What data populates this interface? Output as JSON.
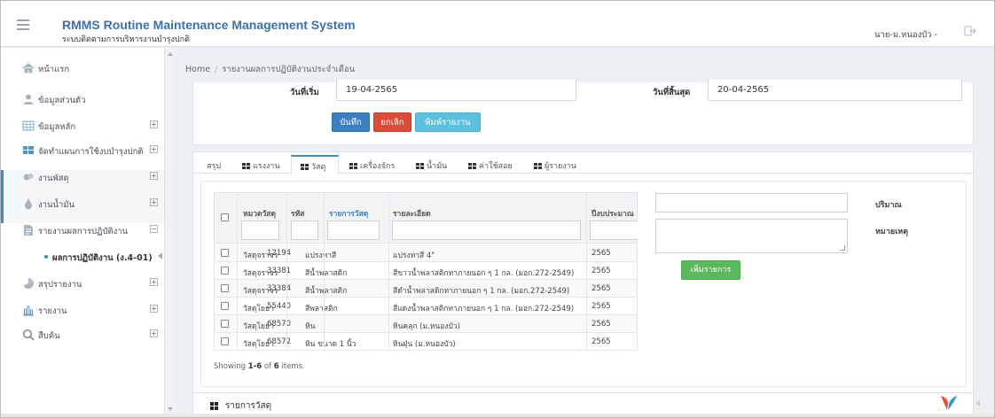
{
  "header": {
    "title": "RMMS Routine Maintenance Management System",
    "subtitle": "ระบบติดตามการบริหารงานบำรุงปกติ",
    "user": "นาย-ม.หนองบัว -"
  },
  "sidebar": {
    "items": [
      {
        "label": "หน้าแรก",
        "icon": "home-icon"
      },
      {
        "label": "ข้อมูลส่วนตัว",
        "icon": "user-icon"
      },
      {
        "label": "ข้อมูลหลัก",
        "icon": "table-icon"
      },
      {
        "label": "จัดทำแผนการใช้งบบำรุงปกติ",
        "icon": "plan-icon"
      },
      {
        "label": "งานพัสดุ",
        "icon": "parcel-icon"
      },
      {
        "label": "งานน้ำมัน",
        "icon": "oil-icon"
      },
      {
        "label": "รายงานผลการปฏิบัติงาน",
        "icon": "report-icon"
      },
      {
        "label": "ผลการปฏิบัติงาน (ง.4-01)",
        "icon": "dot-icon"
      },
      {
        "label": "สรุปรายงาน",
        "icon": "pie-icon"
      },
      {
        "label": "รายงาน",
        "icon": "bar-chart-icon"
      },
      {
        "label": "สืบค้น",
        "icon": "search-icon"
      }
    ]
  },
  "breadcrumb": {
    "home": "Home",
    "current": "รายงานผลการปฏิบัติงานประจำเดือน"
  },
  "form": {
    "start_label": "วันที่เริ่ม",
    "start_value": "19-04-2565",
    "end_label": "วันที่สิ้นสุด",
    "end_value": "20-04-2565",
    "save": "บันทึก",
    "cancel": "ยกเลิก",
    "print": "พิมพ์รายงาน"
  },
  "tabs": [
    "สรุป",
    "แรงงาน",
    "วัสดุ",
    "เครื่องจักร",
    "น้ำมัน",
    "ค่าใช้สอย",
    "ผู้รายงาน"
  ],
  "table": {
    "headers": [
      "หมวดวัสดุ",
      "รหัส",
      "รายการวัสดุ",
      "รายละเอียด",
      "ปีงบประมาณ"
    ],
    "rows": [
      [
        "วัสดุจราจร",
        "12194",
        "แปรงทาสี",
        "แปรงทาสี 4\"",
        "2565"
      ],
      [
        "วัสดุจราจร",
        "33381",
        "สีน้ำพลาสติก",
        "สีขาวน้ำพลาสติกทาภายนอก ๆ 1 กล. (มอก.272-2549)",
        "2565"
      ],
      [
        "วัสดุจราจร",
        "33384",
        "สีน้ำพลาสติก",
        "สีดำน้ำพลาสติกทาภายนอก ๆ 1 กล. (มอก.272-2549)",
        "2565"
      ],
      [
        "วัสดุโยธา",
        "55440",
        "สีพลาสติก",
        "สีแดงน้ำพลาสติกทาภายนอก ๆ 1 กล. (มอก.272-2549)",
        "2565"
      ],
      [
        "วัสดุโยธา",
        "68570",
        "หิน",
        "หินคลุก (ม.หนองบัว)",
        "2565"
      ],
      [
        "วัสดุโยธา",
        "68572",
        "หิน ขนาด 1 นิ้ว",
        "หินฝุ่น (ม.หนองบัว)",
        "2565"
      ]
    ],
    "showing_prefix": "Showing ",
    "showing_range": "1-6",
    "showing_mid": " of ",
    "showing_total": "6",
    "showing_suffix": " items."
  },
  "right_form": {
    "qty_label": "ปริมาณ",
    "note_label": "หมายเหตุ",
    "add_button": "เพิ่มรายการ"
  },
  "bottom": {
    "title": "รายการวัสดุ"
  },
  "colors": {
    "brand_title": "#3c6fb3",
    "save": "#3c7fc1",
    "cancel": "#dd4b39",
    "print": "#5bc0de",
    "add": "#5cb85c"
  }
}
